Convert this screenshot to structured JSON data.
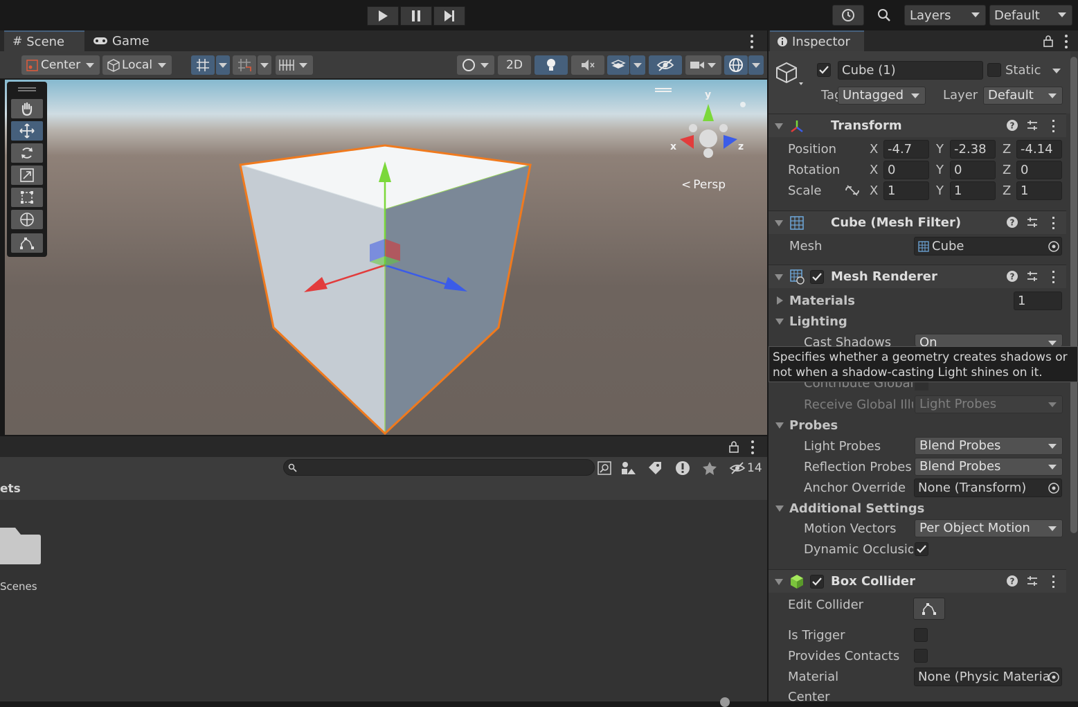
{
  "toolbar": {
    "play": "play-icon",
    "pause": "pause-icon",
    "step": "step-icon",
    "layers_label": "Layers",
    "layout_label": "Default"
  },
  "scene": {
    "tab_scene": "Scene",
    "tab_game": "Game",
    "pivot": "Center",
    "space": "Local",
    "mode_2d": "2D",
    "persp_label": "Persp",
    "gizmo_x": "x",
    "gizmo_y": "y",
    "gizmo_z": "z"
  },
  "project": {
    "breadcrumb": "ets",
    "folder_label": "Scenes",
    "hidden_count": "14"
  },
  "inspector": {
    "tab_label": "Inspector",
    "object_name": "Cube (1)",
    "static_label": "Static",
    "tag_label": "Tag",
    "tag_value": "Untagged",
    "layer_label": "Layer",
    "layer_value": "Default",
    "transform": {
      "title": "Transform",
      "position_label": "Position",
      "rotation_label": "Rotation",
      "scale_label": "Scale",
      "axis_x": "X",
      "axis_y": "Y",
      "axis_z": "Z",
      "position": [
        "-4.7",
        "-2.38",
        "-4.14"
      ],
      "rotation": [
        "0",
        "0",
        "0"
      ],
      "scale": [
        "1",
        "1",
        "1"
      ]
    },
    "mesh_filter": {
      "title": "Cube (Mesh Filter)",
      "mesh_label": "Mesh",
      "mesh_value": "Cube"
    },
    "mesh_renderer": {
      "title": "Mesh Renderer",
      "materials_label": "Materials",
      "materials_count": "1",
      "lighting_label": "Lighting",
      "cast_shadows_label": "Cast Shadows",
      "cast_shadows_value": "On",
      "contribute_gi_label": "Contribute Global",
      "receive_gi_label": "Receive Global Illu",
      "receive_gi_value": "Light Probes",
      "probes_label": "Probes",
      "light_probes_label": "Light Probes",
      "light_probes_value": "Blend Probes",
      "reflection_probes_label": "Reflection Probes",
      "reflection_probes_value": "Blend Probes",
      "anchor_override_label": "Anchor Override",
      "anchor_override_value": "None (Transform)",
      "additional_label": "Additional Settings",
      "motion_vectors_label": "Motion Vectors",
      "motion_vectors_value": "Per Object Motion",
      "dynamic_occlusion_label": "Dynamic Occlusio"
    },
    "box_collider": {
      "title": "Box Collider",
      "edit_collider_label": "Edit Collider",
      "is_trigger_label": "Is Trigger",
      "provides_contacts_label": "Provides Contacts",
      "material_label": "Material",
      "material_value": "None (Physic Materia",
      "center_label": "Center"
    },
    "tooltip": "Specifies whether a geometry creates shadows or not when a shadow-casting Light shines on it."
  },
  "colors": {
    "accent_selected": "#46607c",
    "selection_outline": "#f07a1e",
    "axis_x": "#e23c3c",
    "axis_y": "#7bd83a",
    "axis_z": "#3b5ce8"
  }
}
